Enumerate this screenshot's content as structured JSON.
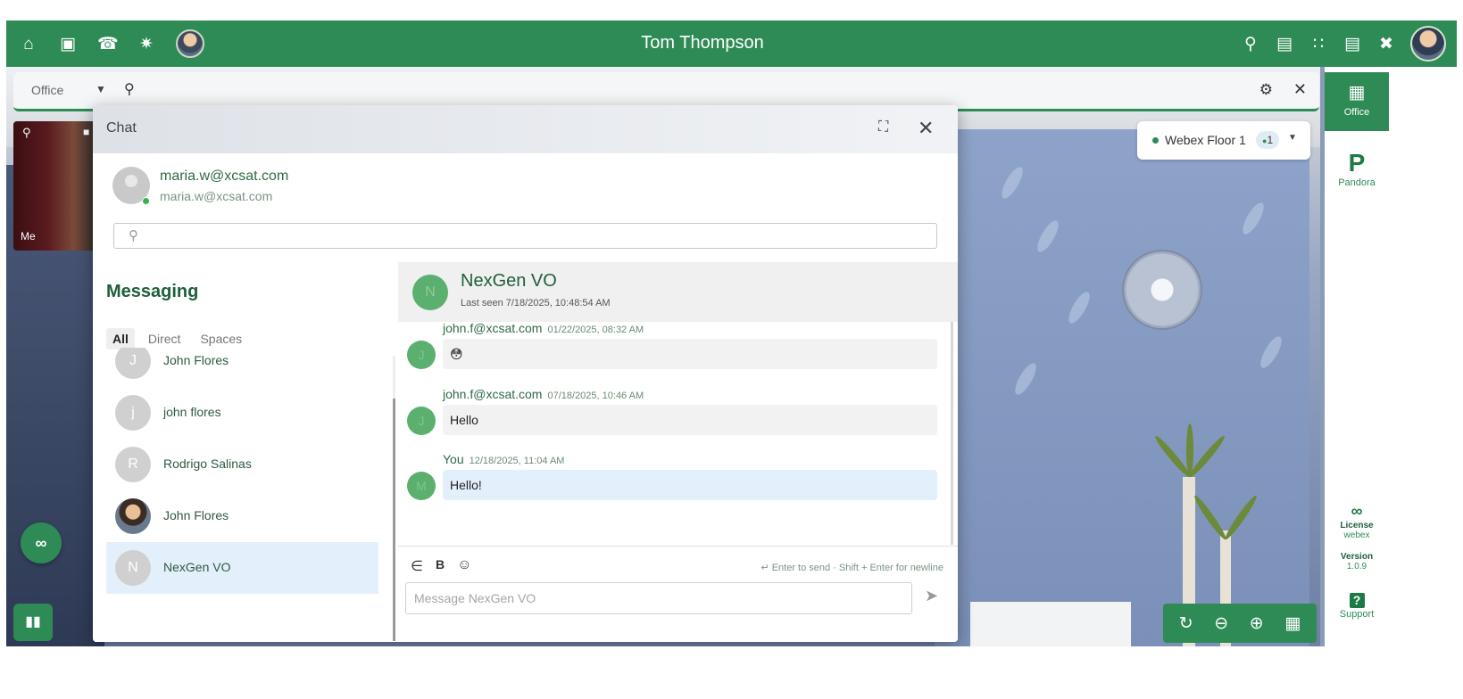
{
  "topbar": {
    "title": "Tom Thompson",
    "left_icons": [
      "home-icon",
      "lock-icon",
      "hangup-icon",
      "walk-icon"
    ],
    "right_icons": [
      "search-icon",
      "map-icon",
      "apps-grid-icon",
      "chat-icon",
      "tools-icon"
    ]
  },
  "addressbar": {
    "location": "Office"
  },
  "sidebar": {
    "office_label": "Office",
    "pandora_label": "Pandora",
    "license_label": "License",
    "license_value": "webex",
    "version_label": "Version",
    "version_value": "1.0.9",
    "support_label": "Support"
  },
  "floor_selector": {
    "name": "Webex Floor 1",
    "count": "1"
  },
  "video": {
    "me_label": "Me"
  },
  "chat": {
    "window_title": "Chat",
    "user": {
      "name": "maria.w@xcsat.com",
      "email": "maria.w@xcsat.com"
    },
    "search_placeholder": "",
    "messaging": {
      "heading": "Messaging",
      "tabs": [
        "All",
        "Direct",
        "Spaces"
      ],
      "contacts": [
        {
          "initial": "J",
          "name": "John Flores"
        },
        {
          "initial": "j",
          "name": "john flores"
        },
        {
          "initial": "R",
          "name": "Rodrigo Salinas"
        },
        {
          "initial": "",
          "name": "John Flores"
        },
        {
          "initial": "N",
          "name": "NexGen VO"
        }
      ]
    },
    "conversation": {
      "avatar_initial": "N",
      "name": "NexGen VO",
      "last_seen": "Last seen 7/18/2025, 10:48:54 AM",
      "messages": [
        {
          "sender": "john.f@xcsat.com",
          "time": "01/22/2025, 08:32 AM",
          "avatar_initial": "J",
          "text": "😳"
        },
        {
          "sender": "john.f@xcsat.com",
          "time": "07/18/2025, 10:46 AM",
          "avatar_initial": "J",
          "text": "Hello"
        },
        {
          "sender": "You",
          "time": "12/18/2025, 11:04 AM",
          "avatar_initial": "M",
          "text": "Hello!"
        }
      ],
      "composer": {
        "hint": "↵ Enter to send · Shift + Enter for newline",
        "placeholder": "Message NexGen VO"
      }
    }
  },
  "colors": {
    "brand_green": "#2e8b55",
    "active_item": "#e3f0fb",
    "online": "#37b34a"
  }
}
